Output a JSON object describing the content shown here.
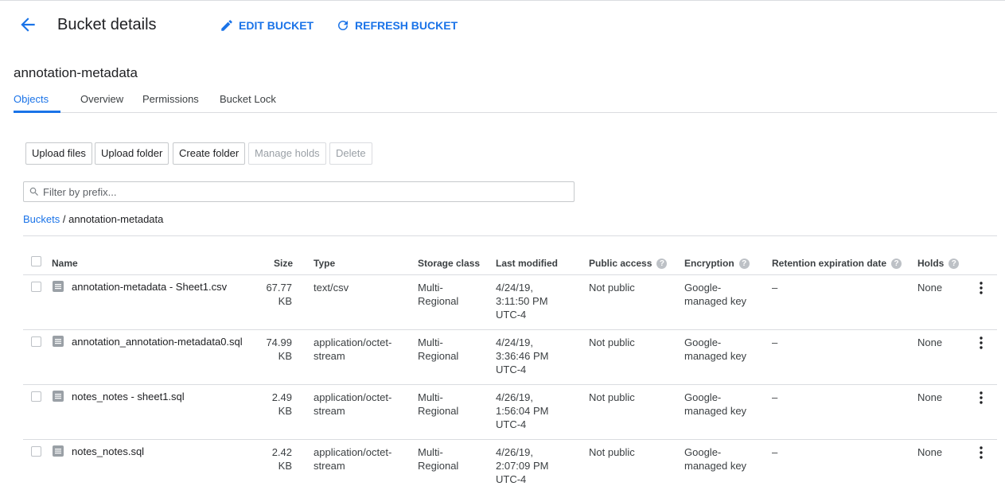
{
  "header": {
    "title": "Bucket details",
    "edit_label": "EDIT BUCKET",
    "refresh_label": "REFRESH BUCKET"
  },
  "bucket_name": "annotation-metadata",
  "tabs": [
    {
      "label": "Objects"
    },
    {
      "label": "Overview"
    },
    {
      "label": "Permissions"
    },
    {
      "label": "Bucket Lock"
    }
  ],
  "toolbar": {
    "upload_files": "Upload files",
    "upload_folder": "Upload folder",
    "create_folder": "Create folder",
    "manage_holds": "Manage holds",
    "delete": "Delete"
  },
  "filter": {
    "placeholder": "Filter by prefix..."
  },
  "breadcrumb": {
    "root": "Buckets",
    "sep": "/",
    "current": "annotation-metadata"
  },
  "columns": {
    "name": "Name",
    "size": "Size",
    "type": "Type",
    "storage": "Storage class",
    "modified": "Last modified",
    "public": "Public access",
    "encryption": "Encryption",
    "retention": "Retention expiration date",
    "holds": "Holds"
  },
  "rows": [
    {
      "name": "annotation-metadata - Sheet1.csv",
      "size1": "67.77",
      "size2": "KB",
      "type1": "text/csv",
      "type2": "",
      "storage1": "Multi-",
      "storage2": "Regional",
      "mod1": "4/24/19,",
      "mod2": "3:11:50 PM",
      "mod3": "UTC-4",
      "public": "Not public",
      "enc1": "Google-",
      "enc2": "managed key",
      "retention": "–",
      "holds": "None"
    },
    {
      "name": "annotation_annotation-metadata0.sql",
      "size1": "74.99",
      "size2": "KB",
      "type1": "application/octet-",
      "type2": "stream",
      "storage1": "Multi-",
      "storage2": "Regional",
      "mod1": "4/24/19,",
      "mod2": "3:36:46 PM",
      "mod3": "UTC-4",
      "public": "Not public",
      "enc1": "Google-",
      "enc2": "managed key",
      "retention": "–",
      "holds": "None"
    },
    {
      "name": "notes_notes - sheet1.sql",
      "size1": "2.49",
      "size2": "KB",
      "type1": "application/octet-",
      "type2": "stream",
      "storage1": "Multi-",
      "storage2": "Regional",
      "mod1": "4/26/19,",
      "mod2": "1:56:04 PM",
      "mod3": "UTC-4",
      "public": "Not public",
      "enc1": "Google-",
      "enc2": "managed key",
      "retention": "–",
      "holds": "None"
    },
    {
      "name": "notes_notes.sql",
      "size1": "2.42",
      "size2": "KB",
      "type1": "application/octet-",
      "type2": "stream",
      "storage1": "Multi-",
      "storage2": "Regional",
      "mod1": "4/26/19,",
      "mod2": "2:07:09 PM",
      "mod3": "UTC-4",
      "public": "Not public",
      "enc1": "Google-",
      "enc2": "managed key",
      "retention": "–",
      "holds": "None"
    }
  ],
  "colors": {
    "accent": "#1a73e8",
    "border": "#dadce0"
  }
}
